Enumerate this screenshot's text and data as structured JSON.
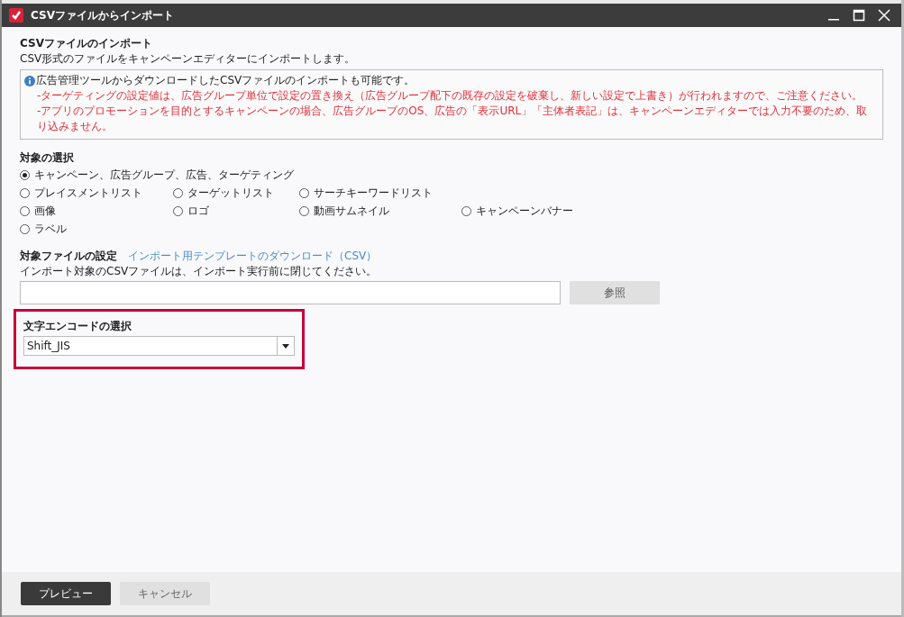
{
  "window": {
    "title": "CSVファイルからインポート"
  },
  "header": {
    "title": "CSVファイルのインポート",
    "description": "CSV形式のファイルをキャンペーンエディターにインポートします。"
  },
  "notice": {
    "info": "広告管理ツールからダウンロードしたCSVファイルのインポートも可能です。",
    "warnings": [
      "-ターゲティングの設定値は、広告グループ単位で設定の置き換え（広告グループ配下の既存の設定を破棄し、新しい設定で上書き）が行われますので、ご注意ください。",
      "-アプリのプロモーションを目的とするキャンペーンの場合、広告グループのOS、広告の「表示URL」「主体者表記」は、キャンペーンエディターでは入力不要のため、取り込みません。"
    ]
  },
  "target": {
    "title": "対象の選択",
    "rows": [
      [
        {
          "label": "キャンペーン、広告グループ、広告、ターゲティング",
          "selected": true
        }
      ],
      [
        {
          "label": "プレイスメントリスト",
          "selected": false
        },
        {
          "label": "ターゲットリスト",
          "selected": false
        },
        {
          "label": "サーチキーワードリスト",
          "selected": false
        }
      ],
      [
        {
          "label": "画像",
          "selected": false
        },
        {
          "label": "ロゴ",
          "selected": false
        },
        {
          "label": "動画サムネイル",
          "selected": false
        },
        {
          "label": "キャンペーンバナー",
          "selected": false
        }
      ],
      [
        {
          "label": "ラベル",
          "selected": false
        }
      ]
    ]
  },
  "file": {
    "title": "対象ファイルの設定",
    "link": "インポート用テンプレートのダウンロード（CSV）",
    "note": "インポート対象のCSVファイルは、インポート実行前に閉じてください。",
    "browse_button": "参照"
  },
  "encoding": {
    "title": "文字エンコードの選択",
    "value": "Shift_JIS",
    "highlighted": true
  },
  "buttons": {
    "primary": "プレビュー",
    "cancel": "キャンセル"
  }
}
